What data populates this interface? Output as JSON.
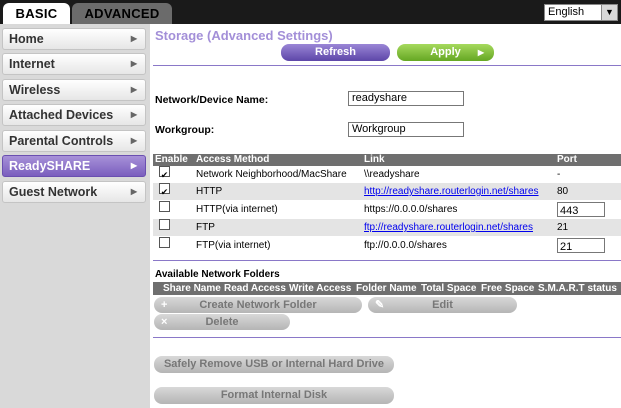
{
  "tabs": {
    "basic": "BASIC",
    "advanced": "ADVANCED"
  },
  "language": {
    "selected": "English"
  },
  "sidebar": {
    "items": [
      {
        "label": "Home"
      },
      {
        "label": "Internet"
      },
      {
        "label": "Wireless"
      },
      {
        "label": "Attached Devices"
      },
      {
        "label": "Parental Controls"
      },
      {
        "label": "ReadySHARE",
        "active": true
      },
      {
        "label": "Guest Network"
      }
    ]
  },
  "page": {
    "title": "Storage (Advanced Settings)",
    "refresh_label": "Refresh",
    "apply_label": "Apply"
  },
  "form": {
    "device_name_label": "Network/Device Name:",
    "device_name_value": "readyshare",
    "workgroup_label": "Workgroup:",
    "workgroup_value": "Workgroup"
  },
  "access_table": {
    "headers": {
      "enable": "Enable",
      "method": "Access Method",
      "link": "Link",
      "port": "Port"
    },
    "rows": [
      {
        "checked": true,
        "check_mark": "✔",
        "method": "Network Neighborhood/MacShare",
        "link": "\\\\readyshare",
        "port": "-"
      },
      {
        "checked": true,
        "check_mark": "✔",
        "method": "HTTP",
        "link": "http://readyshare.routerlogin.net/shares",
        "port": "80"
      },
      {
        "checked": false,
        "check_mark": "",
        "method": "HTTP(via internet)",
        "link": "https://0.0.0.0/shares",
        "port": "443"
      },
      {
        "checked": false,
        "check_mark": "",
        "method": "FTP",
        "link": "ftp://readyshare.routerlogin.net/shares",
        "port": "21"
      },
      {
        "checked": false,
        "check_mark": "",
        "method": "FTP(via internet)",
        "link": "ftp://0.0.0.0/shares",
        "port": "21"
      }
    ]
  },
  "folders": {
    "section_label": "Available Network Folders",
    "headers": [
      "Share Name",
      "Read Access",
      "Write Access",
      "Folder Name",
      "Total Space",
      "Free Space",
      "S.M.A.R.T status"
    ],
    "create_label": "Create Network Folder",
    "edit_label": "Edit",
    "delete_label": "Delete"
  },
  "actions": {
    "safely_remove_label": "Safely Remove USB or Internal Hard Drive",
    "format_label": "Format Internal Disk"
  },
  "colors": {
    "accent": "#7a5ebe",
    "apply": "#65a723",
    "title": "#a38fd8"
  }
}
